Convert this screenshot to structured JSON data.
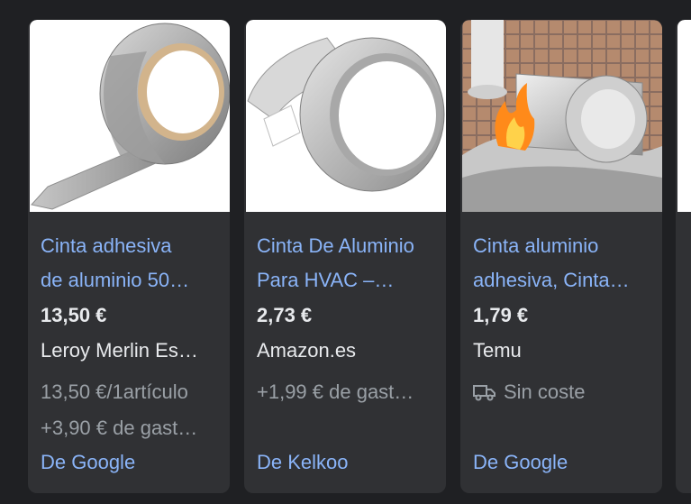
{
  "products": [
    {
      "title_line1": "Cinta adhesiva",
      "title_line2": "de aluminio 50…",
      "price": "13,50 €",
      "merchant": "Leroy Merlin Es…",
      "meta1": "13,50 €/1artículo",
      "meta2": "+3,90 € de gast…",
      "source": "De Google",
      "image_icon": "aluminum-tape-roll-icon"
    },
    {
      "title_line1": "Cinta De Aluminio",
      "title_line2": "Para HVAC –…",
      "price": "2,73 €",
      "merchant": "Amazon.es",
      "meta1": "+1,99 € de gast…",
      "source": "De Kelkoo",
      "image_icon": "aluminum-tape-roll-icon"
    },
    {
      "title_line1": "Cinta aluminio",
      "title_line2": "adhesiva, Cinta…",
      "price": "1,79 €",
      "merchant": "Temu",
      "meta1": "Sin coste",
      "meta1_icon": "truck-icon",
      "source": "De Google",
      "image_icon": "aluminum-tape-fire-icon"
    }
  ],
  "colors": {
    "background": "#1f2023",
    "card": "#303134",
    "link": "#8ab4f8",
    "text": "#e8eaed",
    "muted": "#9aa0a6"
  }
}
